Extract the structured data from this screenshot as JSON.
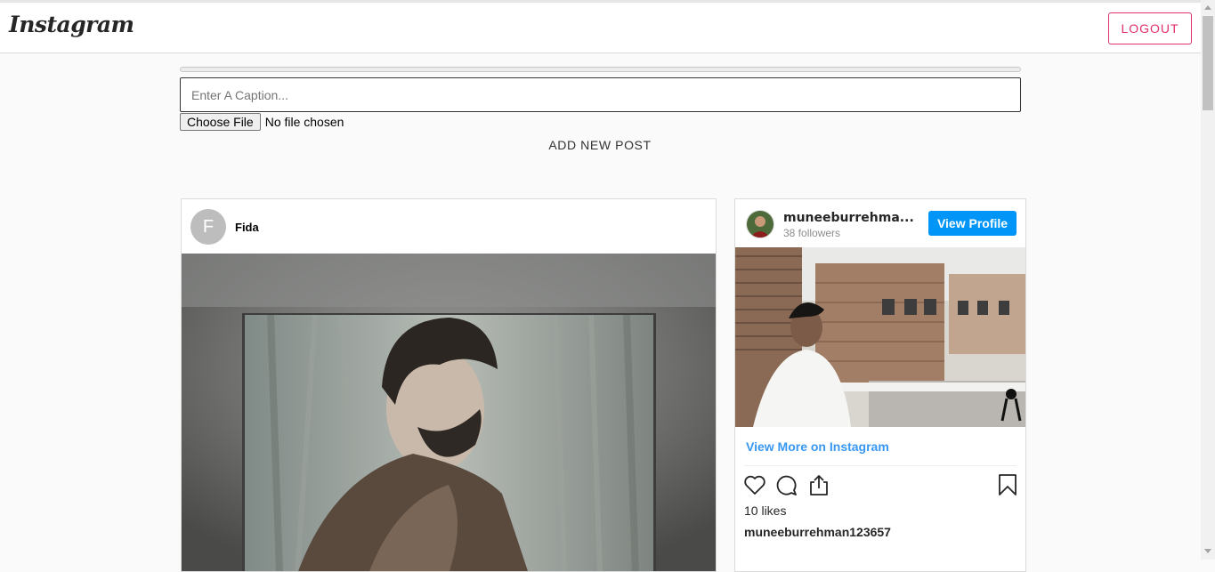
{
  "header": {
    "logo": "Instagram",
    "logout_label": "LOGOUT"
  },
  "upload": {
    "progress": 0,
    "caption_placeholder": "Enter A Caption...",
    "choose_file_label": "Choose File",
    "file_status": "No file chosen",
    "add_post_label": "ADD NEW POST"
  },
  "post": {
    "avatar_letter": "F",
    "username": "Fida"
  },
  "embed": {
    "username": "muneeburrehma...",
    "followers": "38 followers",
    "view_profile_label": "View Profile",
    "view_more_label": "View More on Instagram",
    "likes": "10 likes",
    "caption_user": "muneeburrehman123657"
  },
  "colors": {
    "accent_pink": "#e1306c",
    "instagram_blue": "#0095f6",
    "link_blue": "#3897f0"
  }
}
